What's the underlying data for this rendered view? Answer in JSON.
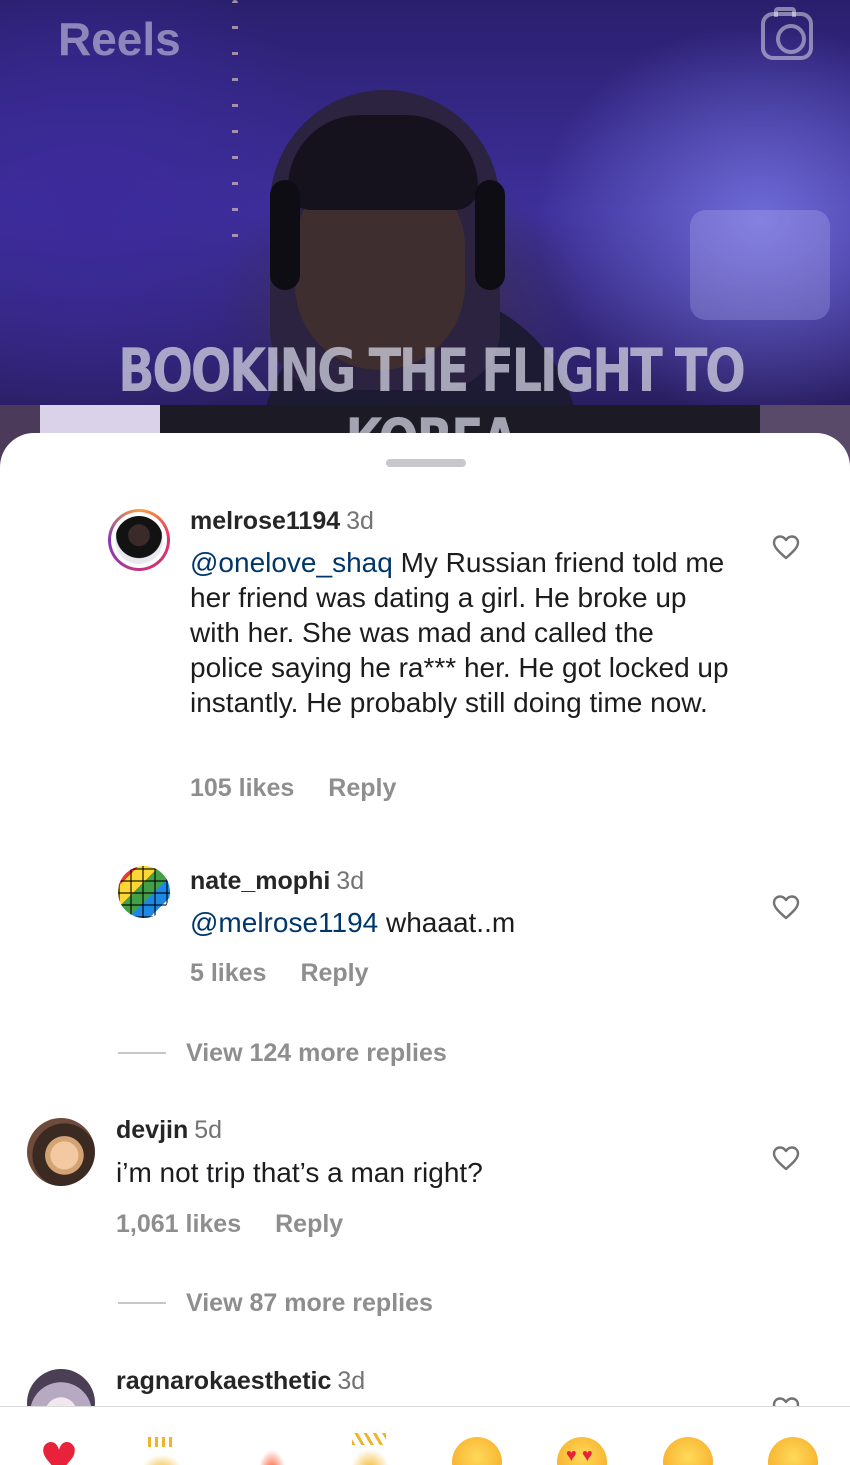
{
  "header": {
    "title": "Reels",
    "camera_icon": "camera-icon"
  },
  "video": {
    "caption": "BOOKING THE FLIGHT TO KOREA"
  },
  "comments": [
    {
      "username": "melrose1194",
      "age": "3d",
      "mention": "@onelove_shaq",
      "text": " My Russian friend told me her friend was dating a girl. He broke up with her. She was mad and called the police saying he ra*** her. He got locked up instantly. He probably still doing time now.",
      "likes": "105 likes",
      "reply_label": "Reply",
      "like_icon": "heart-outline-icon"
    },
    {
      "username": "nate_mophi",
      "age": "3d",
      "mention": "@melrose1194",
      "text": " whaaat..m",
      "likes": "5 likes",
      "reply_label": "Reply",
      "like_icon": "heart-outline-icon"
    },
    {
      "username": "devjin",
      "age": "5d",
      "text": "i’m not trip that’s a man right?",
      "likes": "1,061 likes",
      "reply_label": "Reply",
      "like_icon": "heart-outline-icon"
    },
    {
      "username": "ragnarokaesthetic",
      "age": "3d",
      "like_icon": "heart-outline-icon"
    }
  ],
  "view_more_replies": [
    "View 124 more replies",
    "View 87 more replies"
  ],
  "reactions": [
    "red-heart-emoji",
    "raising-hands-emoji",
    "fire-emoji",
    "clapping-hands-emoji",
    "crying-laughing-face-emoji",
    "heart-eyes-face-emoji",
    "astonished-face-emoji",
    "tears-of-joy-face-emoji"
  ],
  "colors": {
    "mention": "#00376b",
    "secondary_text": "#8e8e8e",
    "primary_text": "#262626"
  }
}
